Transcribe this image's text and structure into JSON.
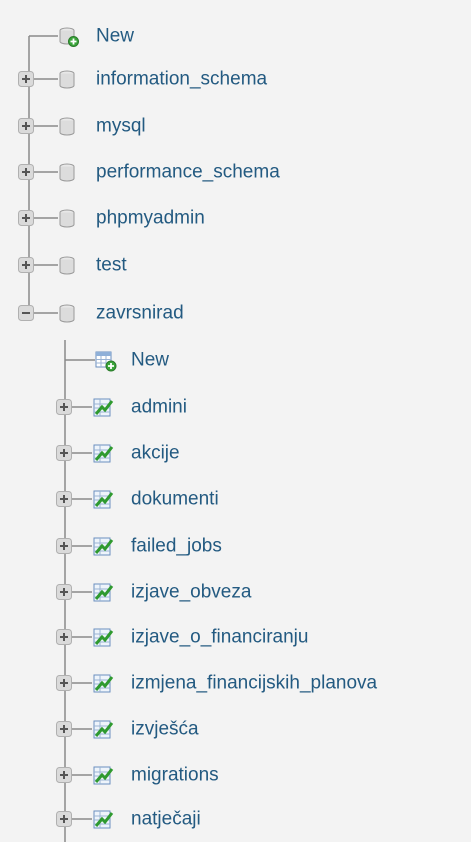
{
  "tree": {
    "databases": [
      {
        "label": "New",
        "kind": "new"
      },
      {
        "label": "information_schema",
        "kind": "db",
        "expanded": false
      },
      {
        "label": "mysql",
        "kind": "db",
        "expanded": false
      },
      {
        "label": "performance_schema",
        "kind": "db",
        "expanded": false
      },
      {
        "label": "phpmyadmin",
        "kind": "db",
        "expanded": false
      },
      {
        "label": "test",
        "kind": "db",
        "expanded": false
      },
      {
        "label": "zavrsnirad",
        "kind": "db",
        "expanded": true,
        "children": [
          {
            "label": "New",
            "kind": "new-table"
          },
          {
            "label": "admini",
            "kind": "table"
          },
          {
            "label": "akcije",
            "kind": "table"
          },
          {
            "label": "dokumenti",
            "kind": "table"
          },
          {
            "label": "failed_jobs",
            "kind": "table"
          },
          {
            "label": "izjave_obveza",
            "kind": "table"
          },
          {
            "label": "izjave_o_financiranju",
            "kind": "table"
          },
          {
            "label": "izmjena_financijskih_planova",
            "kind": "table"
          },
          {
            "label": "izvješća",
            "kind": "table"
          },
          {
            "label": "migrations",
            "kind": "table"
          },
          {
            "label": "natječaji",
            "kind": "table"
          }
        ]
      }
    ]
  },
  "colors": {
    "background": "#f3f3f3",
    "link": "#235a81",
    "tree_line": "#8a8a8a"
  },
  "icons": {
    "expand": "plus-box-icon",
    "collapse": "minus-box-icon",
    "database": "database-cylinder-icon",
    "new": "new-plus-icon",
    "table": "table-icon"
  }
}
